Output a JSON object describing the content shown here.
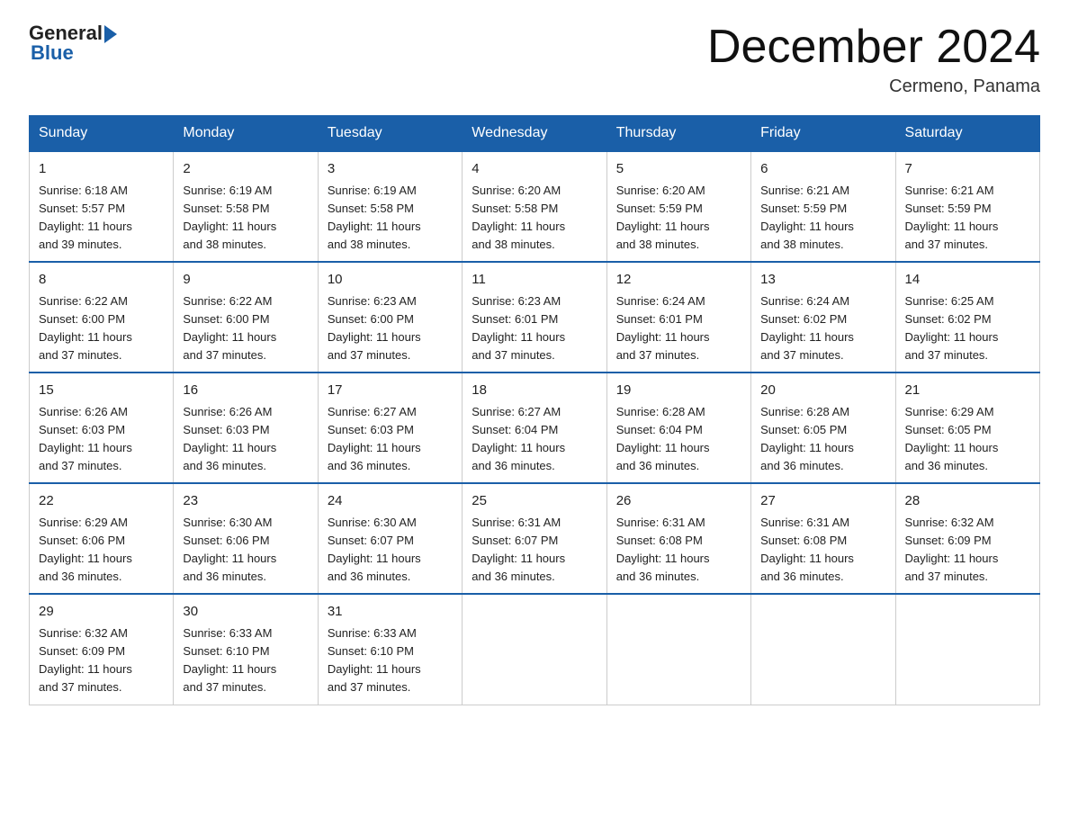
{
  "header": {
    "logo_general": "General",
    "logo_blue": "Blue",
    "month_title": "December 2024",
    "location": "Cermeno, Panama"
  },
  "weekdays": [
    "Sunday",
    "Monday",
    "Tuesday",
    "Wednesday",
    "Thursday",
    "Friday",
    "Saturday"
  ],
  "weeks": [
    [
      {
        "day": "1",
        "sunrise": "6:18 AM",
        "sunset": "5:57 PM",
        "daylight": "11 hours and 39 minutes."
      },
      {
        "day": "2",
        "sunrise": "6:19 AM",
        "sunset": "5:58 PM",
        "daylight": "11 hours and 38 minutes."
      },
      {
        "day": "3",
        "sunrise": "6:19 AM",
        "sunset": "5:58 PM",
        "daylight": "11 hours and 38 minutes."
      },
      {
        "day": "4",
        "sunrise": "6:20 AM",
        "sunset": "5:58 PM",
        "daylight": "11 hours and 38 minutes."
      },
      {
        "day": "5",
        "sunrise": "6:20 AM",
        "sunset": "5:59 PM",
        "daylight": "11 hours and 38 minutes."
      },
      {
        "day": "6",
        "sunrise": "6:21 AM",
        "sunset": "5:59 PM",
        "daylight": "11 hours and 38 minutes."
      },
      {
        "day": "7",
        "sunrise": "6:21 AM",
        "sunset": "5:59 PM",
        "daylight": "11 hours and 37 minutes."
      }
    ],
    [
      {
        "day": "8",
        "sunrise": "6:22 AM",
        "sunset": "6:00 PM",
        "daylight": "11 hours and 37 minutes."
      },
      {
        "day": "9",
        "sunrise": "6:22 AM",
        "sunset": "6:00 PM",
        "daylight": "11 hours and 37 minutes."
      },
      {
        "day": "10",
        "sunrise": "6:23 AM",
        "sunset": "6:00 PM",
        "daylight": "11 hours and 37 minutes."
      },
      {
        "day": "11",
        "sunrise": "6:23 AM",
        "sunset": "6:01 PM",
        "daylight": "11 hours and 37 minutes."
      },
      {
        "day": "12",
        "sunrise": "6:24 AM",
        "sunset": "6:01 PM",
        "daylight": "11 hours and 37 minutes."
      },
      {
        "day": "13",
        "sunrise": "6:24 AM",
        "sunset": "6:02 PM",
        "daylight": "11 hours and 37 minutes."
      },
      {
        "day": "14",
        "sunrise": "6:25 AM",
        "sunset": "6:02 PM",
        "daylight": "11 hours and 37 minutes."
      }
    ],
    [
      {
        "day": "15",
        "sunrise": "6:26 AM",
        "sunset": "6:03 PM",
        "daylight": "11 hours and 37 minutes."
      },
      {
        "day": "16",
        "sunrise": "6:26 AM",
        "sunset": "6:03 PM",
        "daylight": "11 hours and 36 minutes."
      },
      {
        "day": "17",
        "sunrise": "6:27 AM",
        "sunset": "6:03 PM",
        "daylight": "11 hours and 36 minutes."
      },
      {
        "day": "18",
        "sunrise": "6:27 AM",
        "sunset": "6:04 PM",
        "daylight": "11 hours and 36 minutes."
      },
      {
        "day": "19",
        "sunrise": "6:28 AM",
        "sunset": "6:04 PM",
        "daylight": "11 hours and 36 minutes."
      },
      {
        "day": "20",
        "sunrise": "6:28 AM",
        "sunset": "6:05 PM",
        "daylight": "11 hours and 36 minutes."
      },
      {
        "day": "21",
        "sunrise": "6:29 AM",
        "sunset": "6:05 PM",
        "daylight": "11 hours and 36 minutes."
      }
    ],
    [
      {
        "day": "22",
        "sunrise": "6:29 AM",
        "sunset": "6:06 PM",
        "daylight": "11 hours and 36 minutes."
      },
      {
        "day": "23",
        "sunrise": "6:30 AM",
        "sunset": "6:06 PM",
        "daylight": "11 hours and 36 minutes."
      },
      {
        "day": "24",
        "sunrise": "6:30 AM",
        "sunset": "6:07 PM",
        "daylight": "11 hours and 36 minutes."
      },
      {
        "day": "25",
        "sunrise": "6:31 AM",
        "sunset": "6:07 PM",
        "daylight": "11 hours and 36 minutes."
      },
      {
        "day": "26",
        "sunrise": "6:31 AM",
        "sunset": "6:08 PM",
        "daylight": "11 hours and 36 minutes."
      },
      {
        "day": "27",
        "sunrise": "6:31 AM",
        "sunset": "6:08 PM",
        "daylight": "11 hours and 36 minutes."
      },
      {
        "day": "28",
        "sunrise": "6:32 AM",
        "sunset": "6:09 PM",
        "daylight": "11 hours and 37 minutes."
      }
    ],
    [
      {
        "day": "29",
        "sunrise": "6:32 AM",
        "sunset": "6:09 PM",
        "daylight": "11 hours and 37 minutes."
      },
      {
        "day": "30",
        "sunrise": "6:33 AM",
        "sunset": "6:10 PM",
        "daylight": "11 hours and 37 minutes."
      },
      {
        "day": "31",
        "sunrise": "6:33 AM",
        "sunset": "6:10 PM",
        "daylight": "11 hours and 37 minutes."
      },
      null,
      null,
      null,
      null
    ]
  ],
  "labels": {
    "sunrise": "Sunrise:",
    "sunset": "Sunset:",
    "daylight": "Daylight:"
  }
}
